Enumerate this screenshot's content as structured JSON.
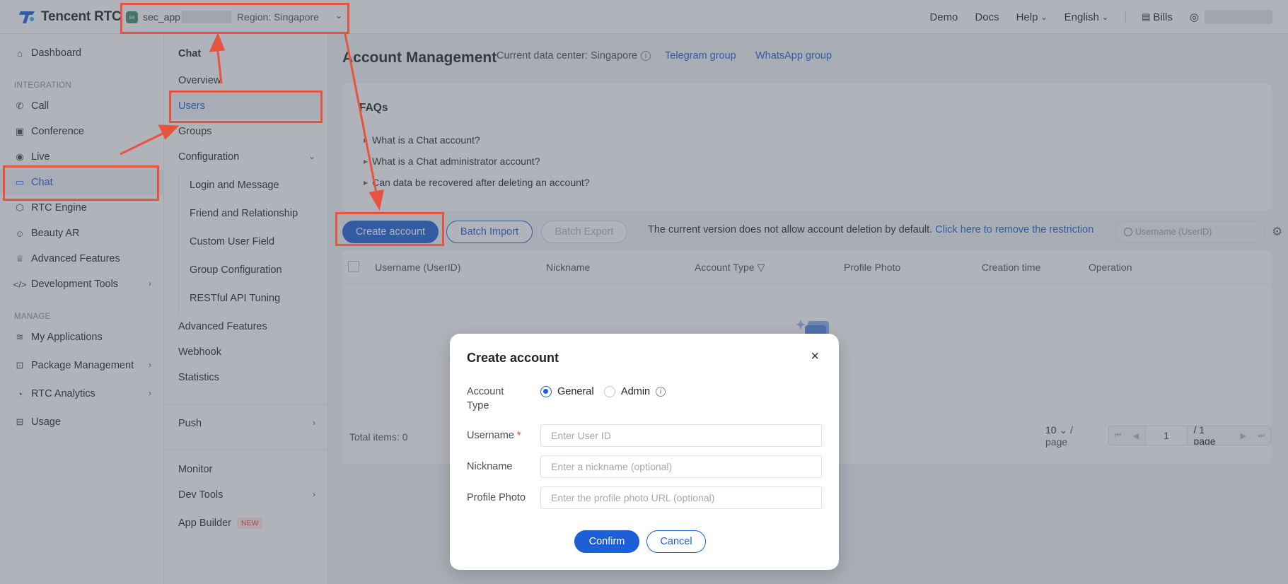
{
  "brand": {
    "name": "Tencent RTC"
  },
  "app_selector": {
    "badge": "se",
    "app_name": "sec_app",
    "region": "Region: Singapore"
  },
  "topnav": {
    "demo": "Demo",
    "docs": "Docs",
    "help": "Help",
    "language": "English",
    "bills": "Bills"
  },
  "sidebar": {
    "dashboard": "Dashboard",
    "integration_label": "INTEGRATION",
    "integration": [
      "Call",
      "Conference",
      "Live",
      "Chat",
      "RTC Engine",
      "Beauty AR",
      "Advanced Features",
      "Development Tools"
    ],
    "manage_label": "MANAGE",
    "manage": [
      "My Applications",
      "Package Management",
      "RTC Analytics",
      "Usage"
    ]
  },
  "subnav": {
    "title": "Chat",
    "items": [
      "Overview",
      "Users",
      "Groups",
      "Configuration"
    ],
    "config_children": [
      "Login and Message",
      "Friend and Relationship",
      "Custom User Field",
      "Group Configuration",
      "RESTful API Tuning"
    ],
    "more": [
      "Advanced Features",
      "Webhook",
      "Statistics"
    ],
    "push": "Push",
    "bottom": [
      "Monitor",
      "Dev Tools",
      "App Builder"
    ],
    "new_badge": "NEW"
  },
  "header": {
    "title": "Account Management",
    "data_center": "Current data center: Singapore",
    "telegram": "Telegram group",
    "whatsapp": "WhatsApp group"
  },
  "faq": {
    "title": "FAQs",
    "items": [
      "What is a Chat account?",
      "What is a Chat administrator account?",
      "Can data be recovered after deleting an account?"
    ]
  },
  "toolbar": {
    "create": "Create account",
    "batch_import": "Batch Import",
    "batch_export": "Batch Export",
    "note": "The current version does not allow account deletion by default.",
    "note_link": "Click here to remove the restriction",
    "search_placeholder": "Username (UserID)"
  },
  "table": {
    "columns": [
      "Username (UserID)",
      "Nickname",
      "Account Type",
      "Profile Photo",
      "Creation time",
      "Operation"
    ],
    "total": "Total items:  0",
    "page_size": "10",
    "per_page": "/ page",
    "page": "1",
    "page_total": "/ 1 page"
  },
  "modal": {
    "title": "Create account",
    "account_type_label": "Account Type",
    "general": "General",
    "admin": "Admin",
    "selected_type": "General",
    "username_label": "Username",
    "username_placeholder": "Enter User ID",
    "nickname_label": "Nickname",
    "nickname_placeholder": "Enter a nickname (optional)",
    "photo_label": "Profile Photo",
    "photo_placeholder": "Enter the profile photo URL (optional)",
    "confirm": "Confirm",
    "cancel": "Cancel"
  },
  "colors": {
    "accent": "#1d5fd6",
    "annotation": "#e8533f"
  }
}
